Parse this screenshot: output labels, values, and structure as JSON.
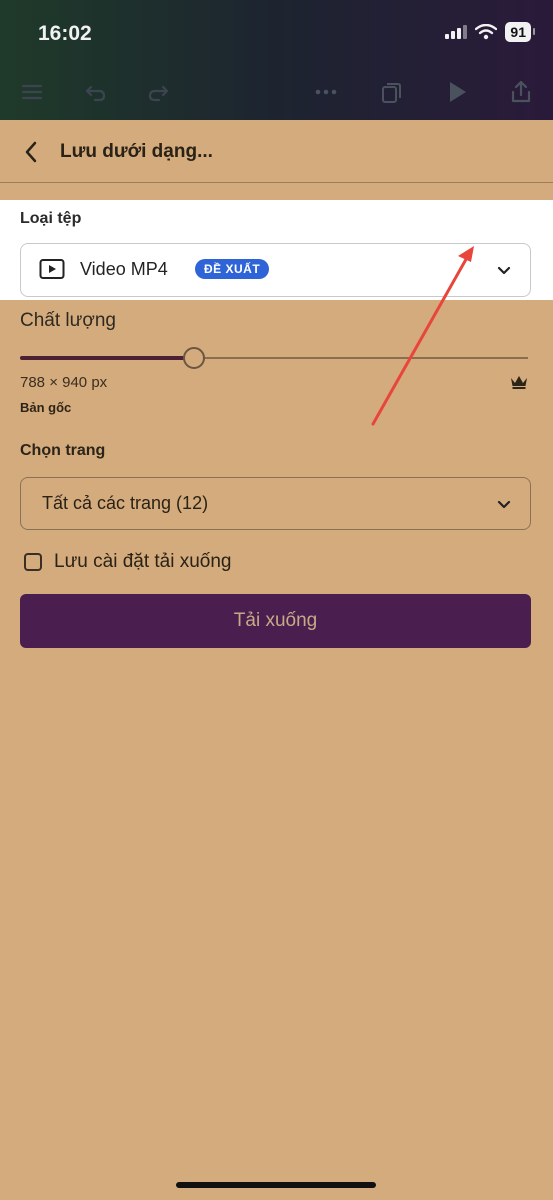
{
  "status_bar": {
    "time": "16:02",
    "battery": "91"
  },
  "sheet": {
    "title": "Lưu dưới dạng...",
    "file_type": {
      "label": "Loại tệp",
      "value": "Video MP4",
      "badge": "ĐỀ XUẤT"
    },
    "quality": {
      "label": "Chất lượng",
      "level": 0.34,
      "dimensions": "788 × 940 px",
      "note": "Bản gốc"
    },
    "pages": {
      "label": "Chọn trang",
      "value": "Tất cả các trang (12)"
    },
    "save_settings": {
      "label": "Lưu cài đặt tải xuống",
      "checked": false
    },
    "download_button": "Tải xuống"
  },
  "colors": {
    "background": "#d4ab7c",
    "primary_button": "#4a1f50",
    "badge": "#2e64d8",
    "annotation_arrow": "#e8453c"
  },
  "icons": [
    "menu-icon",
    "undo-icon",
    "redo-icon",
    "more-icon",
    "pages-icon",
    "play-icon",
    "share-icon",
    "back-icon",
    "video-icon",
    "chevron-down-icon",
    "crown-icon"
  ]
}
